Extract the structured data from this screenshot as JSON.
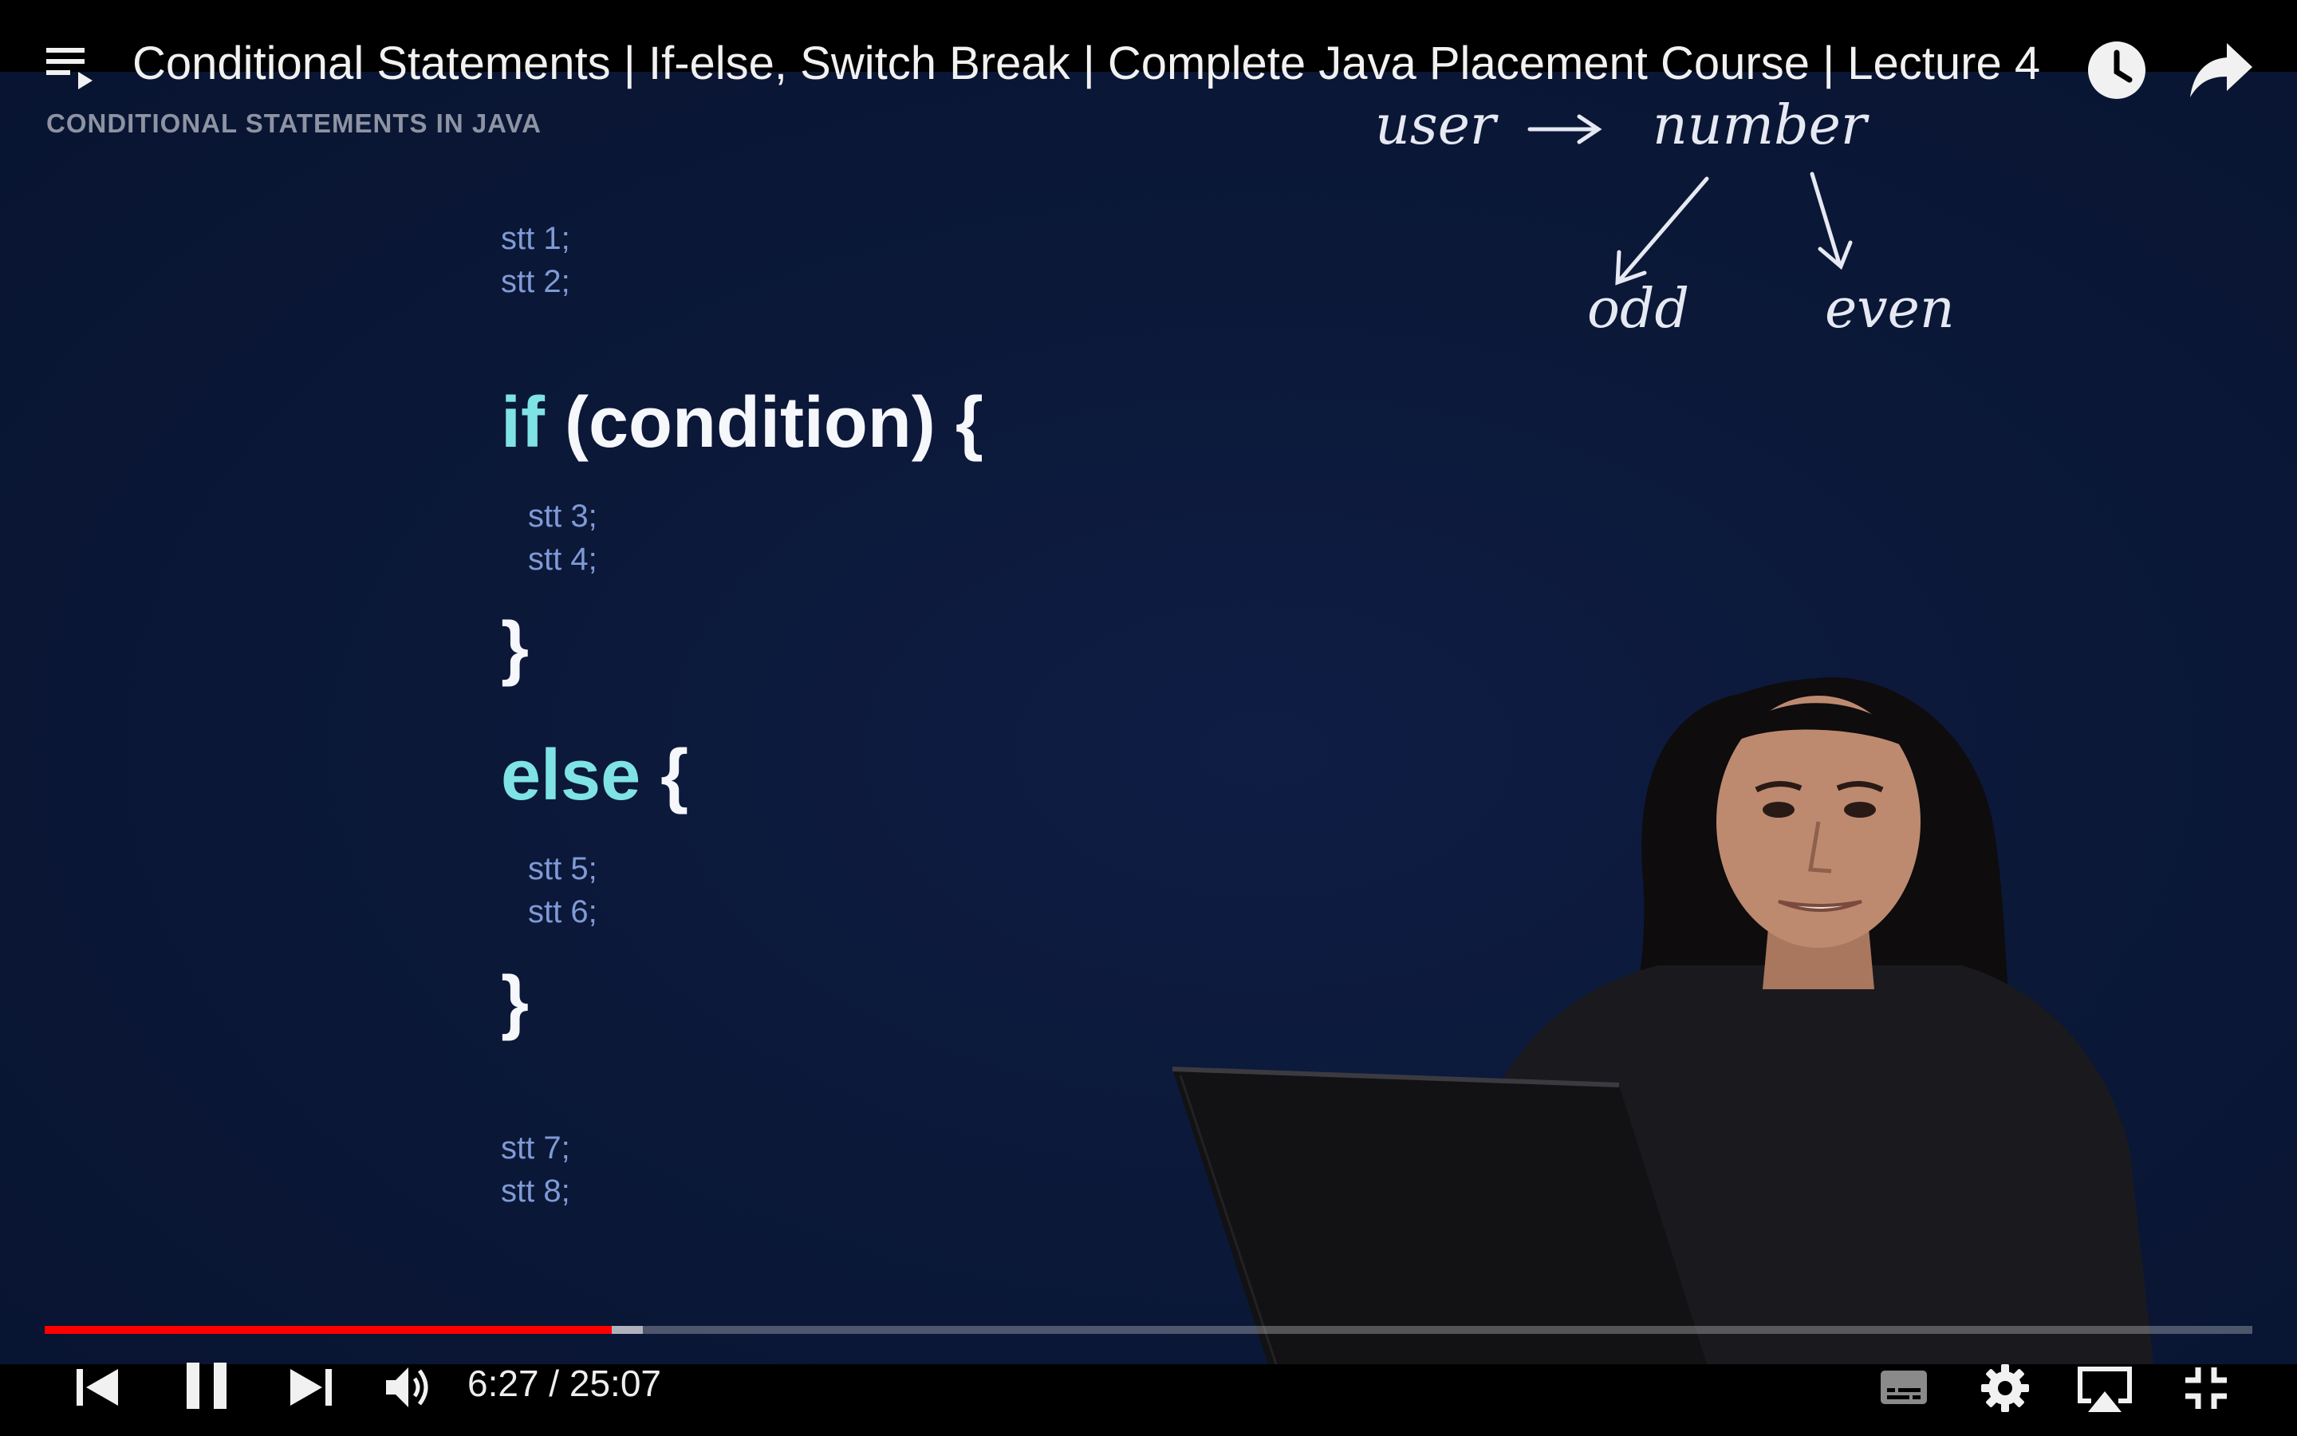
{
  "window": {
    "title": "Conditional Statements | If-else, Switch Break | Complete Java Placement Course | Lecture 4"
  },
  "header": {
    "playlist_icon": "playlist-icon",
    "watch_later_icon": "clock-icon",
    "share_icon": "share-arrow-icon"
  },
  "slide": {
    "heading": "CONDITIONAL STATEMENTS IN JAVA",
    "stt1": "stt 1;",
    "stt2": "stt 2;",
    "if_kw": "if",
    "if_rest": " (condition) {",
    "stt3": "stt 3;",
    "stt4": "stt 4;",
    "close1": "}",
    "else_kw": "else",
    "else_rest": " {",
    "stt5": "stt 5;",
    "stt6": "stt 6;",
    "close2": "}",
    "stt7": "stt 7;",
    "stt8": "stt 8;",
    "handwriting": {
      "user": "user",
      "number": "number",
      "odd": "odd",
      "even": "even"
    }
  },
  "player": {
    "current_time": "6:27",
    "duration": "25:07",
    "time_text": "6:27 / 25:07",
    "played_fraction": 0.257,
    "buffered_fraction": 0.271,
    "progress_color": "#ff0000",
    "controls": {
      "previous_icon": "skip-previous-icon",
      "pause_icon": "pause-icon",
      "next_icon": "skip-next-icon",
      "volume_icon": "volume-icon",
      "subtitles_icon": "subtitles-icon",
      "settings_icon": "gear-icon",
      "airplay_icon": "airplay-icon",
      "exit_fullscreen_icon": "exit-fullscreen-icon"
    }
  }
}
